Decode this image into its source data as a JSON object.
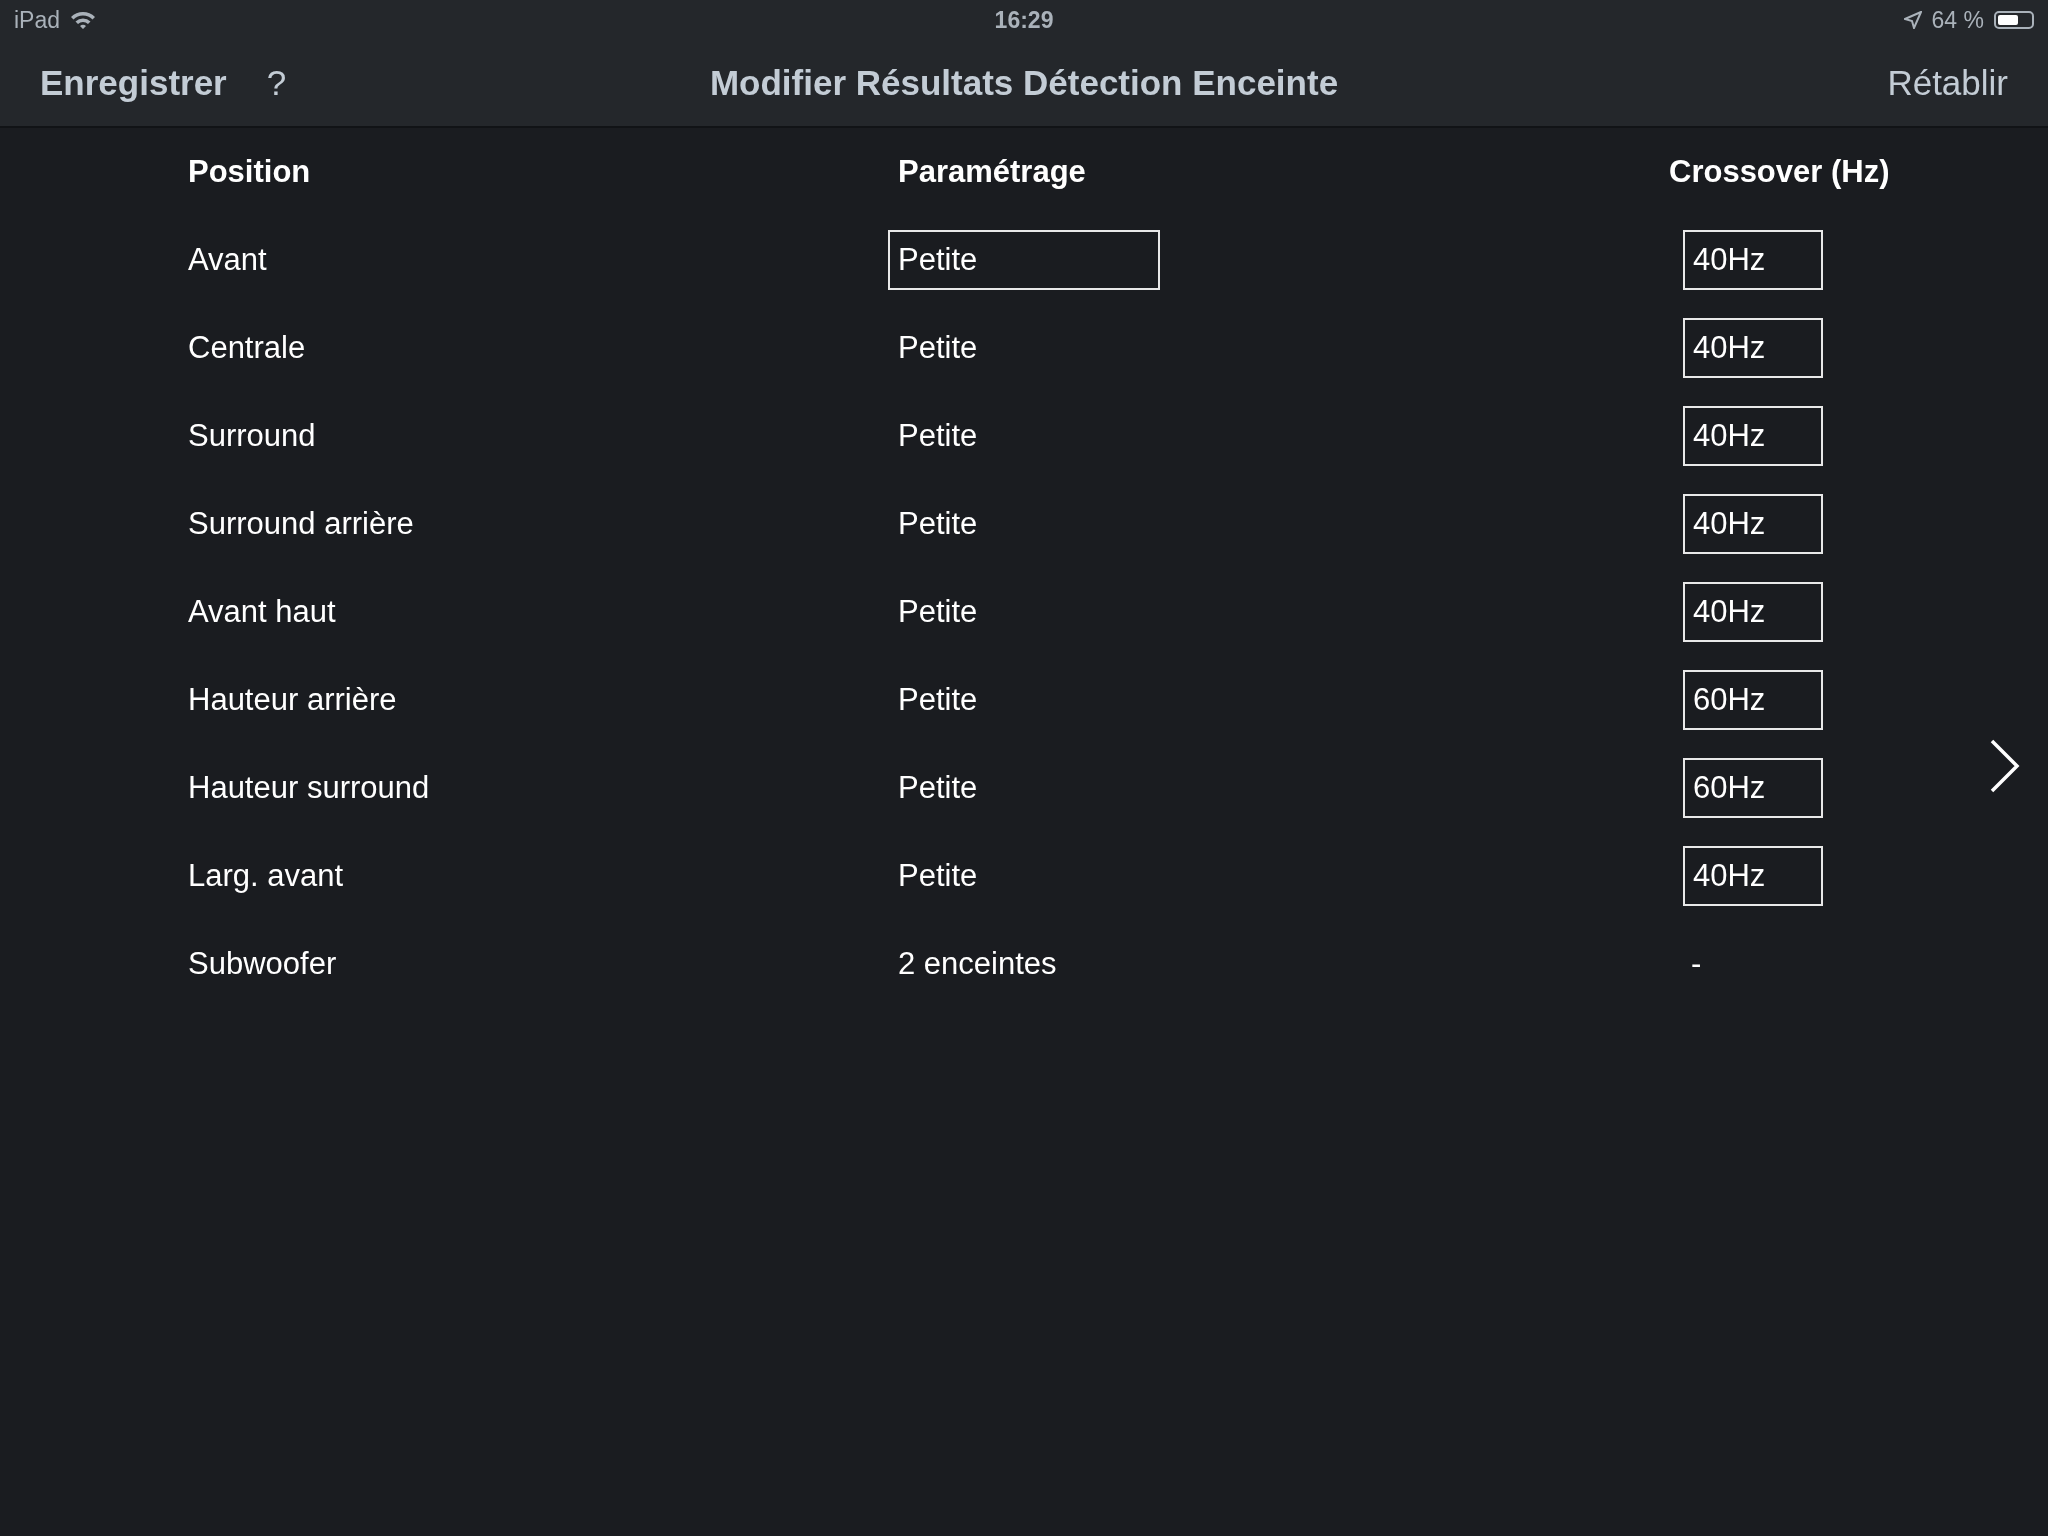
{
  "status_bar": {
    "device": "iPad",
    "time": "16:29",
    "battery": "64 %",
    "battery_icon": {
      "level": 0.64
    }
  },
  "nav_bar": {
    "save": "Enregistrer",
    "help": "?",
    "title": "Modifier Résultats Détection Enceinte",
    "reset": "Rétablir"
  },
  "table": {
    "columns": [
      "Position",
      "Paramétrage",
      "Crossover (Hz)"
    ],
    "rows": [
      {
        "position": "Avant",
        "setting": "Petite",
        "selected": true,
        "crossover": "40Hz",
        "kind": "field"
      },
      {
        "position": "Centrale",
        "setting": "Petite",
        "selected": false,
        "crossover": "40Hz",
        "kind": "field"
      },
      {
        "position": "Surround",
        "setting": "Petite",
        "selected": false,
        "crossover": "40Hz",
        "kind": "field"
      },
      {
        "position": "Surround arrière",
        "setting": "Petite",
        "selected": false,
        "crossover": "40Hz",
        "kind": "field"
      },
      {
        "position": "Avant haut",
        "setting": "Petite",
        "selected": false,
        "crossover": "40Hz",
        "kind": "field"
      },
      {
        "position": "Hauteur arrière",
        "setting": "Petite",
        "selected": false,
        "crossover": "60Hz",
        "kind": "field"
      },
      {
        "position": "Hauteur surround",
        "setting": "Petite",
        "selected": false,
        "crossover": "60Hz",
        "kind": "field"
      },
      {
        "position": "Larg. avant",
        "setting": "Petite",
        "selected": false,
        "crossover": "40Hz",
        "kind": "field"
      },
      {
        "position": "Subwoofer",
        "setting": "2 enceintes",
        "selected": false,
        "crossover": "-",
        "kind": "text"
      }
    ]
  }
}
